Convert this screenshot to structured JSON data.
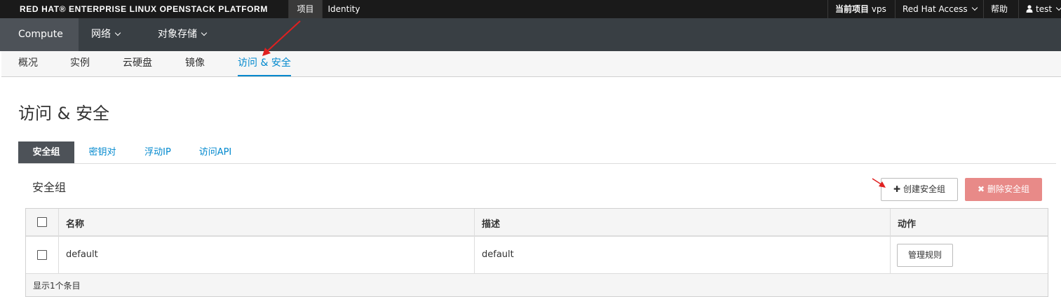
{
  "topbar": {
    "brand": "RED HAT® ENTERPRISE LINUX OPENSTACK PLATFORM",
    "tabs": [
      {
        "label": "项目"
      },
      {
        "label": "Identity"
      }
    ],
    "current_project_label": "当前项目",
    "current_project_value": "vps",
    "red_hat_access": "Red Hat Access",
    "help": "帮助",
    "user": "test"
  },
  "nav": {
    "items": [
      {
        "label": "Compute"
      },
      {
        "label": "网络"
      },
      {
        "label": "对象存储"
      }
    ]
  },
  "subnav": {
    "items": [
      {
        "label": "概况"
      },
      {
        "label": "实例"
      },
      {
        "label": "云硬盘"
      },
      {
        "label": "镜像"
      },
      {
        "label": "访问 & 安全"
      }
    ]
  },
  "page": {
    "title": "访问 & 安全",
    "tabs": [
      {
        "label": "安全组"
      },
      {
        "label": "密钥对"
      },
      {
        "label": "浮动IP"
      },
      {
        "label": "访问API"
      }
    ],
    "section_title": "安全组",
    "create_button": "创建安全组",
    "delete_button": "删除安全组"
  },
  "table": {
    "headers": {
      "name": "名称",
      "description": "描述",
      "actions": "动作"
    },
    "rows": [
      {
        "name": "default",
        "description": "default",
        "action": "管理规则"
      }
    ],
    "footer": "显示1个条目"
  },
  "colors": {
    "topbar": "#1a1a1a",
    "navbar": "#393f44",
    "accent": "#0088ce",
    "danger": "#e88a88",
    "annotation_arrow": "#e02020"
  },
  "icons": {
    "user": "user-icon",
    "plus": "plus-icon",
    "delete": "close-icon",
    "caret": "chevron-down-icon"
  }
}
